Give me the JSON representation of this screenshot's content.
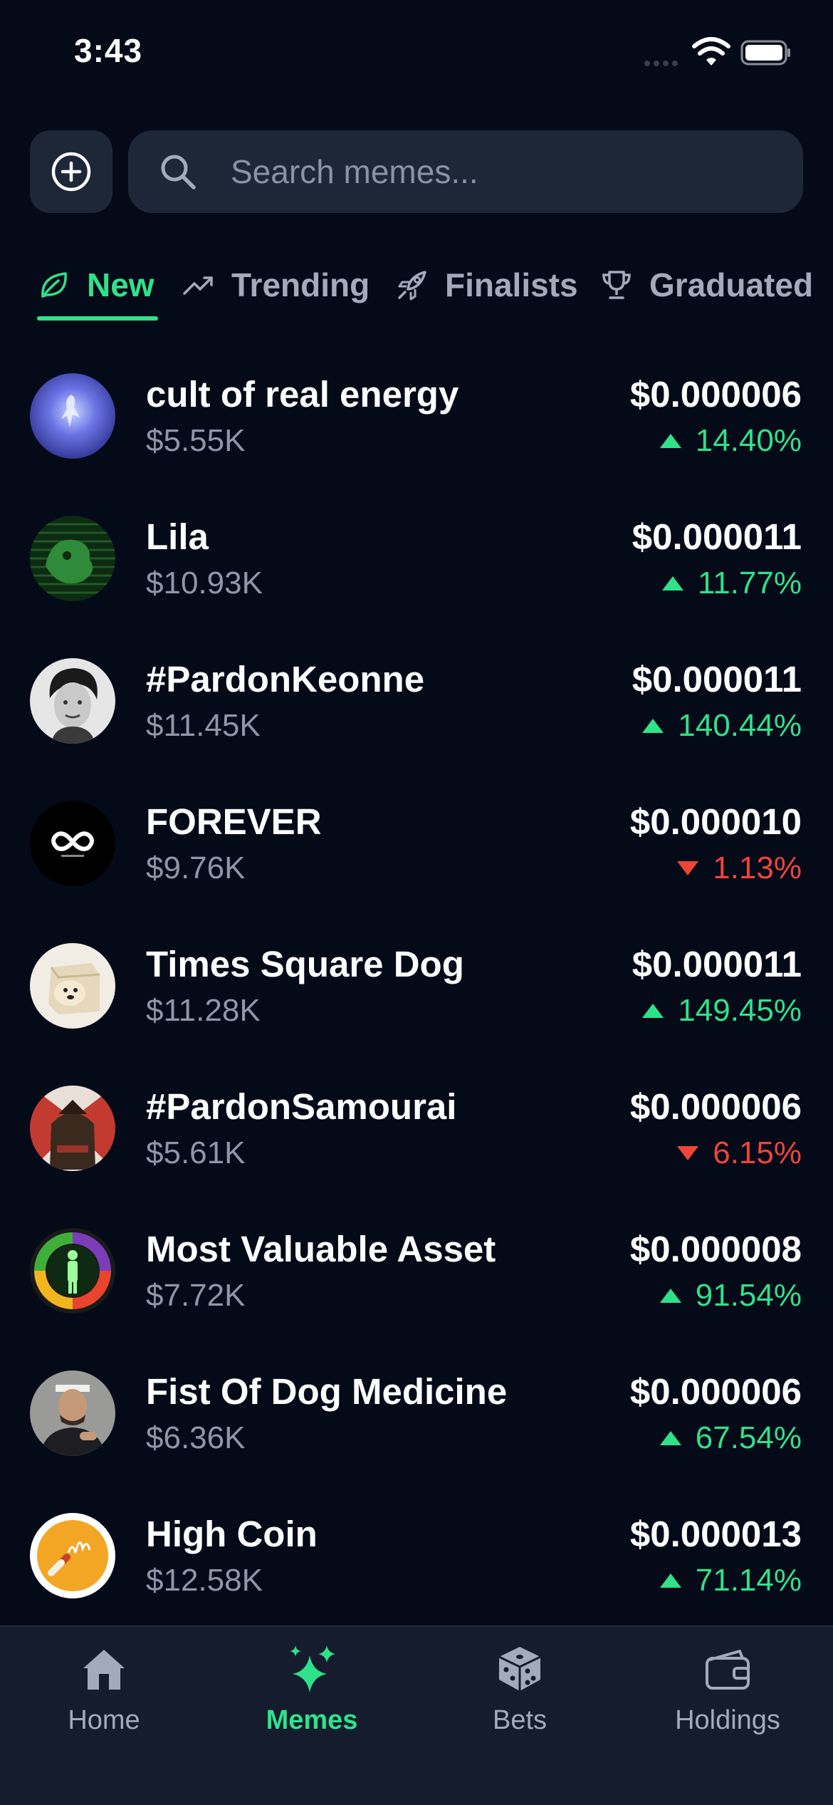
{
  "status_bar": {
    "time": "3:43",
    "icons": [
      "signal-dots-icon",
      "wifi-icon",
      "battery-icon"
    ]
  },
  "search": {
    "placeholder": "Search memes...",
    "value": "",
    "add_icon": "plus-circle-icon",
    "search_icon": "magnifier-icon"
  },
  "tabs": [
    {
      "label": "New",
      "icon": "leaf-icon",
      "active": true
    },
    {
      "label": "Trending",
      "icon": "trending-up-icon",
      "active": false
    },
    {
      "label": "Finalists",
      "icon": "rocket-icon",
      "active": false
    },
    {
      "label": "Graduated",
      "icon": "trophy-icon",
      "active": false
    }
  ],
  "memes": [
    {
      "name": "cult of real energy",
      "market_cap": "$5.55K",
      "price": "$0.000006",
      "change": "14.40%",
      "direction": "up"
    },
    {
      "name": "Lila",
      "market_cap": "$10.93K",
      "price": "$0.000011",
      "change": "11.77%",
      "direction": "up"
    },
    {
      "name": "#PardonKeonne",
      "market_cap": "$11.45K",
      "price": "$0.000011",
      "change": "140.44%",
      "direction": "up"
    },
    {
      "name": "FOREVER",
      "market_cap": "$9.76K",
      "price": "$0.000010",
      "change": "1.13%",
      "direction": "down"
    },
    {
      "name": "Times Square Dog",
      "market_cap": "$11.28K",
      "price": "$0.000011",
      "change": "149.45%",
      "direction": "up"
    },
    {
      "name": "#PardonSamourai",
      "market_cap": "$5.61K",
      "price": "$0.000006",
      "change": "6.15%",
      "direction": "down"
    },
    {
      "name": "Most Valuable Asset",
      "market_cap": "$7.72K",
      "price": "$0.000008",
      "change": "91.54%",
      "direction": "up"
    },
    {
      "name": "Fist Of Dog Medicine",
      "market_cap": "$6.36K",
      "price": "$0.000006",
      "change": "67.54%",
      "direction": "up"
    },
    {
      "name": "High Coin",
      "market_cap": "$12.58K",
      "price": "$0.000013",
      "change": "71.14%",
      "direction": "up"
    }
  ],
  "bottom_nav": [
    {
      "label": "Home",
      "icon": "home-icon",
      "active": false
    },
    {
      "label": "Memes",
      "icon": "sparkles-icon",
      "active": true
    },
    {
      "label": "Bets",
      "icon": "dice-icon",
      "active": false
    },
    {
      "label": "Holdings",
      "icon": "wallet-icon",
      "active": false
    }
  ],
  "colors": {
    "background": "#050a19",
    "surface": "#1e2738",
    "accent": "#2fe28a",
    "negative": "#f0443a",
    "muted_text": "#8e97aa"
  }
}
